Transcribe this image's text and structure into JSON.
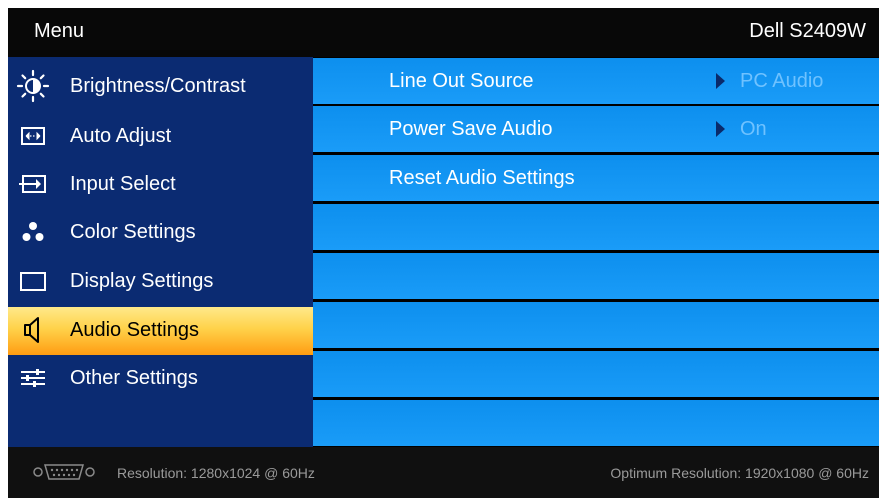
{
  "header": {
    "title": "Menu",
    "model": "Dell S2409W"
  },
  "sidebar": {
    "items": [
      {
        "label": "Brightness/Contrast",
        "icon": "brightness-icon",
        "active": false
      },
      {
        "label": "Auto Adjust",
        "icon": "auto-adjust-icon",
        "active": false
      },
      {
        "label": "Input Select",
        "icon": "input-select-icon",
        "active": false
      },
      {
        "label": "Color Settings",
        "icon": "color-settings-icon",
        "active": false
      },
      {
        "label": "Display Settings",
        "icon": "display-settings-icon",
        "active": false
      },
      {
        "label": "Audio Settings",
        "icon": "speaker-icon",
        "active": true
      },
      {
        "label": "Other Settings",
        "icon": "sliders-icon",
        "active": false
      }
    ]
  },
  "audio": {
    "rows": [
      {
        "label": "Line Out Source",
        "value": "PC Audio"
      },
      {
        "label": "Power Save Audio",
        "value": "On"
      },
      {
        "label": "Reset Audio Settings",
        "value": ""
      }
    ]
  },
  "footer": {
    "resolution": "Resolution: 1280x1024 @ 60Hz",
    "optimum": "Optimum Resolution: 1920x1080 @ 60Hz",
    "connector_icon": "vga-connector-icon"
  },
  "colors": {
    "sidebar_bg": "#0b2b72",
    "row_bg": "#1696f5",
    "active_highlight": "#ffc83a",
    "value_text": "#6fc2ff"
  }
}
